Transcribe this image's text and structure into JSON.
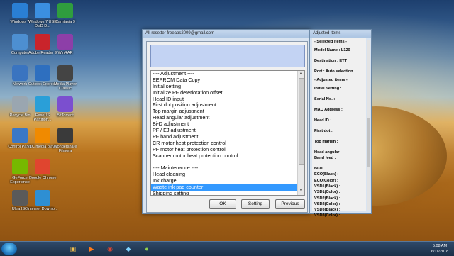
{
  "desktop": {
    "icons": [
      {
        "label": "Windows 7",
        "color": "#2a7fd4"
      },
      {
        "label": "Windows 7 USB DVD D...",
        "color": "#3b8fe0"
      },
      {
        "label": "Camtasia 9",
        "color": "#2f9d3e"
      },
      {
        "label": "Computer",
        "color": "#4d8fd1"
      },
      {
        "label": "Adobe Reader 9",
        "color": "#c9242b"
      },
      {
        "label": "WinRAR",
        "color": "#8d3fa8"
      },
      {
        "label": "Network",
        "color": "#3a74c0"
      },
      {
        "label": "Outlook Express",
        "color": "#2e6fbf"
      },
      {
        "label": "Media Player Classic",
        "color": "#444444"
      },
      {
        "label": "Recycle Bin",
        "color": "#9aa6b0"
      },
      {
        "label": "EaseUS Partition...",
        "color": "#2a9fd8"
      },
      {
        "label": "BitTorrent",
        "color": "#7b4fcf"
      },
      {
        "label": "Control Panel",
        "color": "#3b78c6"
      },
      {
        "label": "VLC media player",
        "color": "#f08a00"
      },
      {
        "label": "Wondershare Filmora",
        "color": "#3a3a3a"
      },
      {
        "label": "GeForce Experience",
        "color": "#76b900"
      },
      {
        "label": "Google Chrome",
        "color": "#e0452f"
      },
      {
        "label": "",
        "color": ""
      },
      {
        "label": "Ultra ISO",
        "color": "#5a5a5a"
      },
      {
        "label": "Internet Downlo...",
        "color": "#2e8fd3"
      },
      {
        "label": "",
        "color": ""
      }
    ]
  },
  "main_window": {
    "title": "All resetter freeaps2009@gmail.com",
    "controls": {
      "minimize": "–",
      "maximize": "□",
      "close": "×"
    },
    "list_items": [
      "---- Adjustment ----",
      "EEPROM Data Copy",
      "Initial setting",
      "Initialize PF deterioration offset",
      "Head ID input",
      "First dot position adjustment",
      "Top margin adjustment",
      "Head angular adjustment",
      "Bi-D adjustment",
      "PF / EJ adjustment",
      "PF band adjustment",
      "CR motor heat protection control",
      "PF motor heat protection control",
      "Scanner motor heat protection control",
      "",
      "---- Maintenance ----",
      "Head cleaning",
      "Ink charge",
      "Waste ink pad counter",
      "Shipping setting"
    ],
    "selected_index": 18,
    "buttons": {
      "ok": "OK",
      "setting": "Setting",
      "previous": "Previous"
    }
  },
  "adjusted_window": {
    "title": "Adjusted items",
    "rows": [
      "- Selected items -",
      "Model Name : L120",
      "Destination : ETT",
      "Port : Auto selection",
      "- Adjusted items -",
      "Initial Setting :",
      "Serial No. :",
      "MAC Address :",
      "Head ID :",
      "First dot :",
      "Top margin :",
      "Head angular",
      "Band feed :",
      "Bi-D",
      "ECO(Black) :",
      "ECO(Color) :",
      "VSD1(Black) :",
      "VSD1(Color) :",
      "VSD2(Black) :",
      "VSD2(Color) :",
      "VSD3(Black) :",
      "VSD3(Color) :"
    ]
  },
  "taskbar": {
    "apps": [
      {
        "name": "explorer-icon",
        "glyph": "▣",
        "color": "#f2c14e"
      },
      {
        "name": "media-player-icon",
        "glyph": "▶",
        "color": "#ff7a1a"
      },
      {
        "name": "chrome-icon",
        "glyph": "◉",
        "color": "#e0452f"
      },
      {
        "name": "filmora-icon",
        "glyph": "◆",
        "color": "#7fd3ff"
      },
      {
        "name": "resetter-icon",
        "glyph": "●",
        "color": "#8fd14f"
      }
    ],
    "time": "5:08 AM",
    "date": "6/11/2018"
  }
}
